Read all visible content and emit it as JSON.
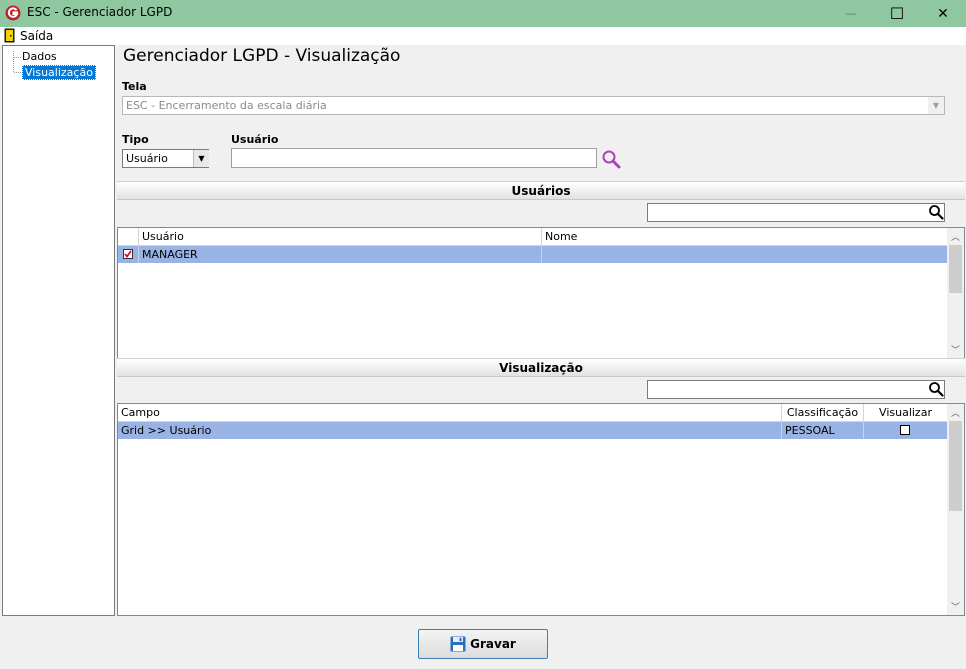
{
  "window": {
    "title": "ESC - Gerenciador LGPD",
    "minimize_glyph": "—",
    "maximize_glyph": "☐",
    "close_glyph": "✕"
  },
  "menu": {
    "exit_label": "Saída",
    "exit_icon": "exit-door-icon"
  },
  "tree": {
    "items": [
      "Dados",
      "Visualização"
    ],
    "selected": "Visualização"
  },
  "page": {
    "title": "Gerenciador LGPD - Visualização"
  },
  "form": {
    "tela_label": "Tela",
    "tela_value": "ESC - Encerramento da escala diária",
    "tipo_label": "Tipo",
    "tipo_value": "Usuário",
    "usuario_label": "Usuário",
    "usuario_value": ""
  },
  "users_section": {
    "header": "Usuários",
    "filter_value": "",
    "columns": [
      "Usuário",
      "Nome"
    ],
    "rows": [
      {
        "checked": true,
        "usuario": "MANAGER",
        "nome": ""
      }
    ]
  },
  "view_section": {
    "header": "Visualização",
    "filter_value": "",
    "columns": [
      "Campo",
      "Classificação",
      "Visualizar"
    ],
    "rows": [
      {
        "campo": "Grid >> Usuário",
        "classificacao": "PESSOAL",
        "visualizar": false
      }
    ]
  },
  "actions": {
    "save_label": "Gravar",
    "save_icon": "floppy-disk-icon"
  },
  "colors": {
    "titlebar": "#8fc8a0",
    "selection_row": "#99b4e4",
    "tree_selection": "#0078d7",
    "search_icon_purple": "#b040c0",
    "button_border": "#3c7fb1"
  }
}
